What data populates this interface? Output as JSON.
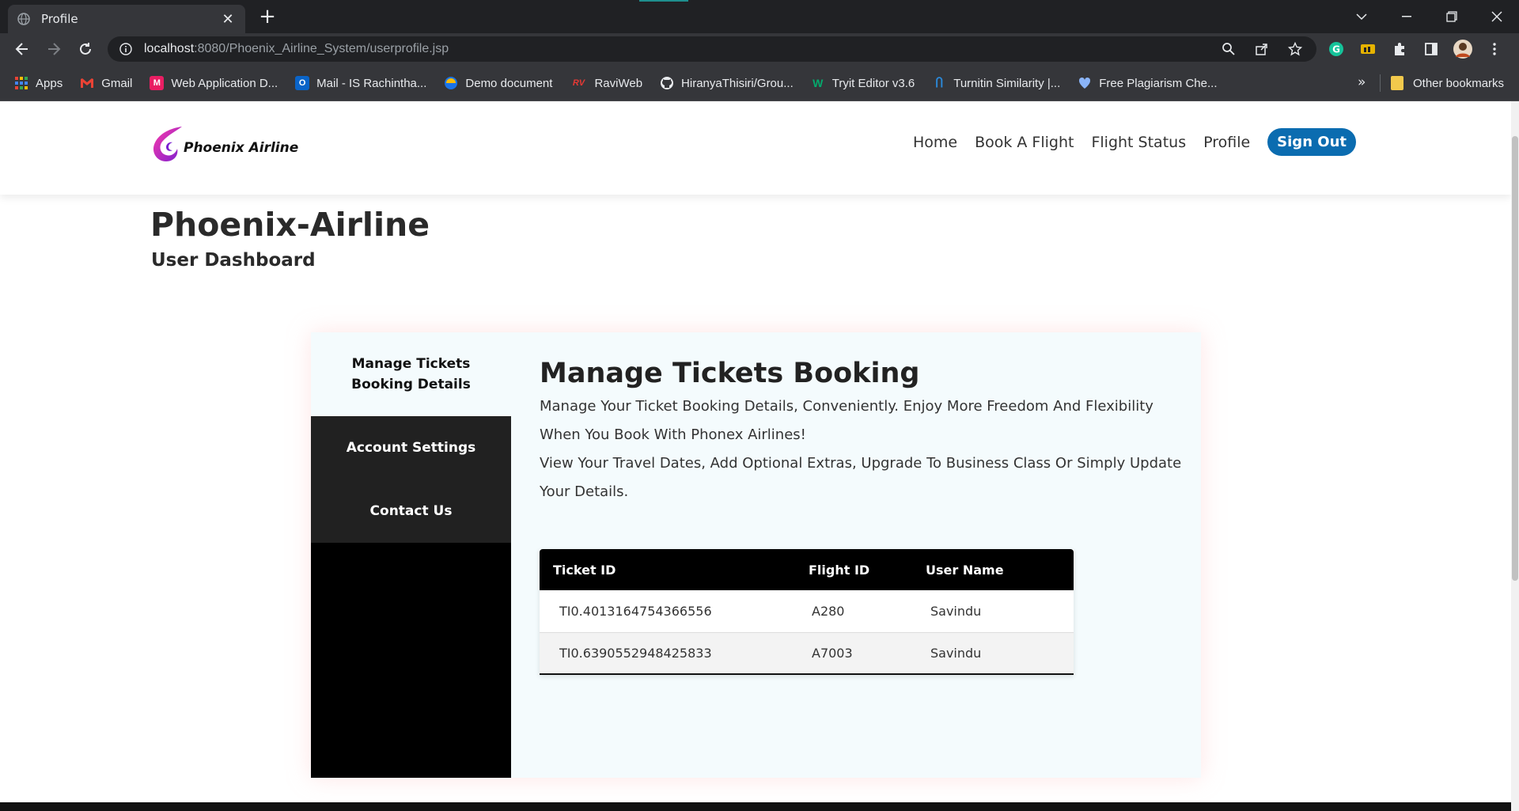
{
  "browser": {
    "tab_title": "Profile",
    "url_host": "localhost",
    "url_rest": ":8080/Phoenix_Airline_System/userprofile.jsp",
    "bookmarks": [
      {
        "label": "Apps",
        "icon": "apps-grid-icon"
      },
      {
        "label": "Gmail",
        "icon": "gmail-icon"
      },
      {
        "label": "Web Application D...",
        "icon": "m-app-icon"
      },
      {
        "label": "Mail - IS Rachintha...",
        "icon": "outlook-icon"
      },
      {
        "label": "Demo document",
        "icon": "doc-icon"
      },
      {
        "label": "RaviWeb",
        "icon": "rv-icon"
      },
      {
        "label": "HiranyaThisiri/Grou...",
        "icon": "github-icon"
      },
      {
        "label": "Tryit Editor v3.6",
        "icon": "w3-icon"
      },
      {
        "label": "Turnitin Similarity |...",
        "icon": "turnitin-icon"
      },
      {
        "label": "Free Plagiarism Che...",
        "icon": "plagiarism-icon"
      }
    ],
    "bookmarks_more": "»",
    "other_bookmarks": "Other bookmarks"
  },
  "site": {
    "logo_text": "Phoenix Airline",
    "nav": {
      "home": "Home",
      "book": "Book A Flight",
      "status": "Flight Status",
      "profile": "Profile",
      "signout": "Sign Out"
    }
  },
  "page": {
    "title": "Phoenix-Airline",
    "subtitle": "User Dashboard"
  },
  "sidebar": {
    "manage": "Manage Tickets Booking Details",
    "account": "Account Settings",
    "contact": "Contact Us"
  },
  "content": {
    "title": "Manage Tickets Booking",
    "desc1": "Manage Your Ticket Booking Details, Conveniently. Enjoy More Freedom And Flexibility When You Book With Phonex Airlines!",
    "desc2": "View Your Travel Dates, Add Optional Extras, Upgrade To Business Class Or Simply Update Your Details."
  },
  "table": {
    "headers": [
      "Ticket ID",
      "Flight ID",
      "User Name"
    ],
    "rows": [
      [
        "TI0.4013164754366556",
        "A280",
        "Savindu"
      ],
      [
        "TI0.6390552948425833",
        "A7003",
        "Savindu"
      ]
    ]
  },
  "colors": {
    "signout_button": "#0b6cb0",
    "sidebar_dark": "#212121",
    "panel_bg": "#f4fbfd",
    "browser_dark": "#202124"
  }
}
